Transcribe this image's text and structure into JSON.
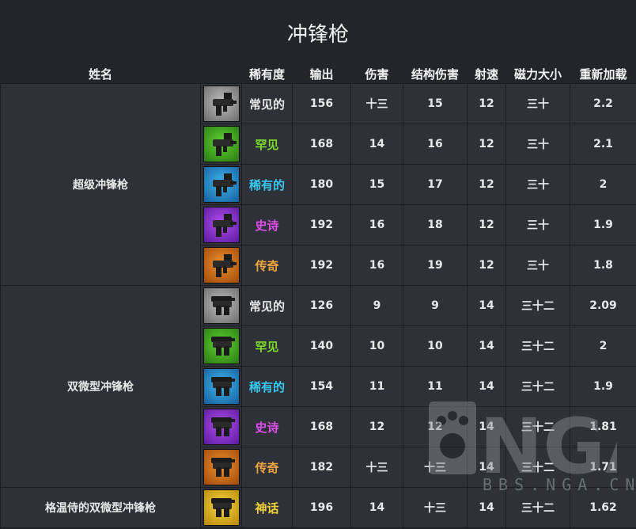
{
  "title": "冲锋枪",
  "headers": {
    "name": "姓名",
    "rarity": "稀有度",
    "dps": "输出",
    "damage": "伤害",
    "structure_damage": "结构伤害",
    "fire_rate": "射速",
    "magazine": "磁力大小",
    "reload": "重新加载"
  },
  "colors": {
    "common": "#e6e6e6",
    "uncommon": "#7ddc2a",
    "rare": "#36c9f2",
    "epic": "#e24ff0",
    "legendary": "#f2a640",
    "mythic": "#f5d33c"
  },
  "weapons": [
    {
      "name": "超级冲锋枪",
      "rows": [
        {
          "rarity": "常见的",
          "tier": "common",
          "dps": "156",
          "damage": "十三",
          "structure_damage": "15",
          "fire_rate": "12",
          "magazine": "三十",
          "reload": "2.2"
        },
        {
          "rarity": "罕见",
          "tier": "uncommon",
          "dps": "168",
          "damage": "14",
          "structure_damage": "16",
          "fire_rate": "12",
          "magazine": "三十",
          "reload": "2.1"
        },
        {
          "rarity": "稀有的",
          "tier": "rare",
          "dps": "180",
          "damage": "15",
          "structure_damage": "17",
          "fire_rate": "12",
          "magazine": "三十",
          "reload": "2"
        },
        {
          "rarity": "史诗",
          "tier": "epic",
          "dps": "192",
          "damage": "16",
          "structure_damage": "18",
          "fire_rate": "12",
          "magazine": "三十",
          "reload": "1.9"
        },
        {
          "rarity": "传奇",
          "tier": "legendary",
          "dps": "192",
          "damage": "16",
          "structure_damage": "19",
          "fire_rate": "12",
          "magazine": "三十",
          "reload": "1.8"
        }
      ]
    },
    {
      "name": "双微型冲锋枪",
      "rows": [
        {
          "rarity": "常见的",
          "tier": "common",
          "dps": "126",
          "damage": "9",
          "structure_damage": "9",
          "fire_rate": "14",
          "magazine": "三十二",
          "reload": "2.09"
        },
        {
          "rarity": "罕见",
          "tier": "uncommon",
          "dps": "140",
          "damage": "10",
          "structure_damage": "10",
          "fire_rate": "14",
          "magazine": "三十二",
          "reload": "2"
        },
        {
          "rarity": "稀有的",
          "tier": "rare",
          "dps": "154",
          "damage": "11",
          "structure_damage": "11",
          "fire_rate": "14",
          "magazine": "三十二",
          "reload": "1.9"
        },
        {
          "rarity": "史诗",
          "tier": "epic",
          "dps": "168",
          "damage": "12",
          "structure_damage": "12",
          "fire_rate": "14",
          "magazine": "三十二",
          "reload": "1.81"
        },
        {
          "rarity": "传奇",
          "tier": "legendary",
          "dps": "182",
          "damage": "十三",
          "structure_damage": "十三",
          "fire_rate": "14",
          "magazine": "三十二",
          "reload": "1.71"
        }
      ]
    },
    {
      "name": "格温侍的双微型冲锋枪",
      "rows": [
        {
          "rarity": "神话",
          "tier": "mythic",
          "dps": "196",
          "damage": "14",
          "structure_damage": "十三",
          "fire_rate": "14",
          "magazine": "三十二",
          "reload": "1.62"
        }
      ]
    }
  ],
  "watermark": {
    "logo": "NGA",
    "site": "BBS.NGA.CN"
  }
}
